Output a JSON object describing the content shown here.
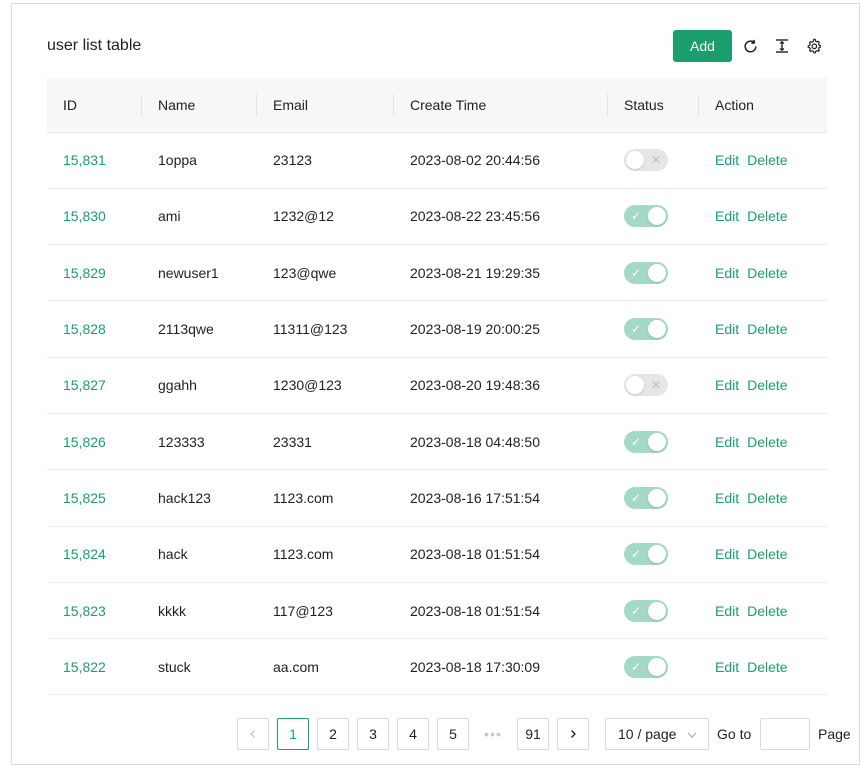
{
  "header": {
    "title": "user list table",
    "add_label": "Add",
    "icons": [
      "reload-icon",
      "column-height-icon",
      "settings-icon"
    ]
  },
  "columns": [
    "ID",
    "Name",
    "Email",
    "Create Time",
    "Status",
    "Action"
  ],
  "rows": [
    {
      "id": "15,831",
      "name": "1oppa",
      "email": "23123",
      "create_time": "2023-08-02 20:44:56",
      "status": false,
      "edit": "Edit",
      "delete": "Delete"
    },
    {
      "id": "15,830",
      "name": "ami",
      "email": "1232@12",
      "create_time": "2023-08-22 23:45:56",
      "status": true,
      "edit": "Edit",
      "delete": "Delete"
    },
    {
      "id": "15,829",
      "name": "newuser1",
      "email": "123@qwe",
      "create_time": "2023-08-21 19:29:35",
      "status": true,
      "edit": "Edit",
      "delete": "Delete"
    },
    {
      "id": "15,828",
      "name": "2113qwe",
      "email": "11311@123",
      "create_time": "2023-08-19 20:00:25",
      "status": true,
      "edit": "Edit",
      "delete": "Delete"
    },
    {
      "id": "15,827",
      "name": "ggahh",
      "email": "1230@123",
      "create_time": "2023-08-20 19:48:36",
      "status": false,
      "edit": "Edit",
      "delete": "Delete"
    },
    {
      "id": "15,826",
      "name": "123333",
      "email": "23331",
      "create_time": "2023-08-18 04:48:50",
      "status": true,
      "edit": "Edit",
      "delete": "Delete"
    },
    {
      "id": "15,825",
      "name": "hack123",
      "email": "1123.com",
      "create_time": "2023-08-16 17:51:54",
      "status": true,
      "edit": "Edit",
      "delete": "Delete"
    },
    {
      "id": "15,824",
      "name": "hack",
      "email": "1123.com",
      "create_time": "2023-08-18 01:51:54",
      "status": true,
      "edit": "Edit",
      "delete": "Delete"
    },
    {
      "id": "15,823",
      "name": "kkkk",
      "email": "117@123",
      "create_time": "2023-08-18 01:51:54",
      "status": true,
      "edit": "Edit",
      "delete": "Delete"
    },
    {
      "id": "15,822",
      "name": "stuck",
      "email": "aa.com",
      "create_time": "2023-08-18 17:30:09",
      "status": true,
      "edit": "Edit",
      "delete": "Delete"
    }
  ],
  "pagination": {
    "prev": "<",
    "next": ">",
    "pages": [
      "1",
      "2",
      "3",
      "4",
      "5"
    ],
    "ellipsis": "•••",
    "last_page": "91",
    "current_page": "1",
    "page_size": "10 / page",
    "goto_label": "Go to",
    "goto_value": "",
    "page_label": "Page"
  },
  "colors": {
    "accent": "#1a9e6e",
    "switch_on": "#a3d9c5",
    "switch_off": "#e6e6e6",
    "header_bg": "#f7f7f7"
  }
}
